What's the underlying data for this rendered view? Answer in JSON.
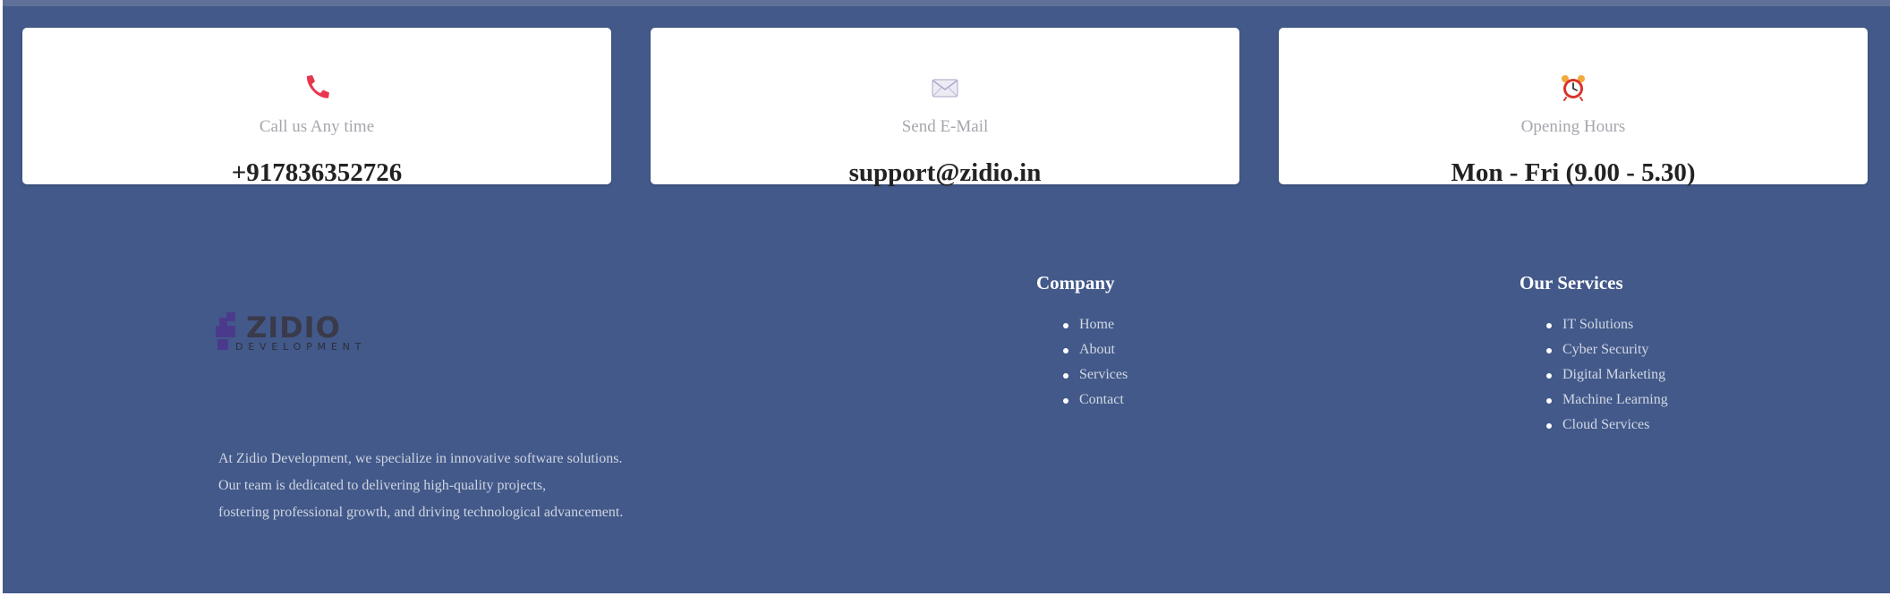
{
  "contact_cards": [
    {
      "icon": "phone-icon",
      "label": "Call us Any time",
      "value": "+917836352726"
    },
    {
      "icon": "mail-icon",
      "label": "Send E-Mail",
      "value": "support@zidio.in"
    },
    {
      "icon": "alarm-clock-icon",
      "label": "Opening Hours",
      "value": "Mon - Fri (9.00 - 5.30)"
    }
  ],
  "logo": {
    "wordmark": "ZIDIO",
    "tagline": "DEVELOPMENT"
  },
  "about": {
    "line1": "At Zidio Development, we specialize in innovative software solutions.",
    "line2": "Our team is dedicated to delivering high-quality projects,",
    "line3": "fostering professional growth, and driving technological advancement."
  },
  "company": {
    "title": "Company",
    "links": [
      "Home",
      "About",
      "Services",
      "Contact"
    ]
  },
  "services": {
    "title": "Our Services",
    "links": [
      "IT Solutions",
      "Cyber Security",
      "Digital Marketing",
      "Machine Learning",
      "Cloud Services"
    ]
  },
  "colors": {
    "footer_bg": "#42598a",
    "card_bg": "#ffffff",
    "phone_red": "#e8364f",
    "clock_red": "#d9342b",
    "logo_purple": "#4b3a8c"
  }
}
